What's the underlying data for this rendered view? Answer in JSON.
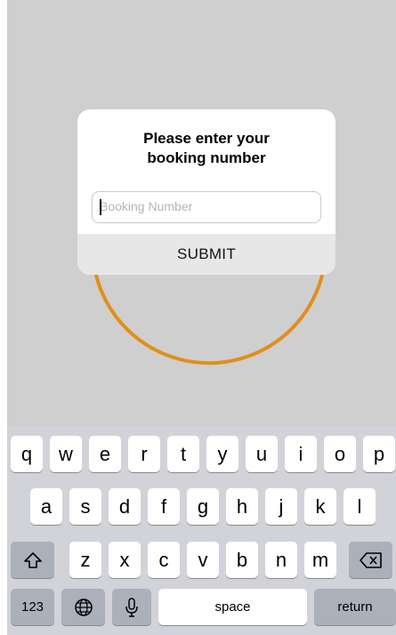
{
  "dialog": {
    "title_line1": "Please enter your",
    "title_line2": "booking number",
    "input_placeholder": "Booking Number",
    "input_value": "",
    "submit_label": "SUBMIT"
  },
  "colors": {
    "ring": "#e08f1a",
    "backdrop": "#cfcfcf",
    "keyboard_bg": "#d1d3d9"
  },
  "keyboard": {
    "row1": [
      "q",
      "w",
      "e",
      "r",
      "t",
      "y",
      "u",
      "i",
      "o",
      "p"
    ],
    "row2": [
      "a",
      "s",
      "d",
      "f",
      "g",
      "h",
      "j",
      "k",
      "l"
    ],
    "row3": [
      "z",
      "x",
      "c",
      "v",
      "b",
      "n",
      "m"
    ],
    "shift_icon": "shift-icon",
    "backspace_icon": "backspace-icon",
    "numbers_label": "123",
    "globe_icon": "globe-icon",
    "mic_icon": "microphone-icon",
    "space_label": "space",
    "return_label": "return"
  }
}
